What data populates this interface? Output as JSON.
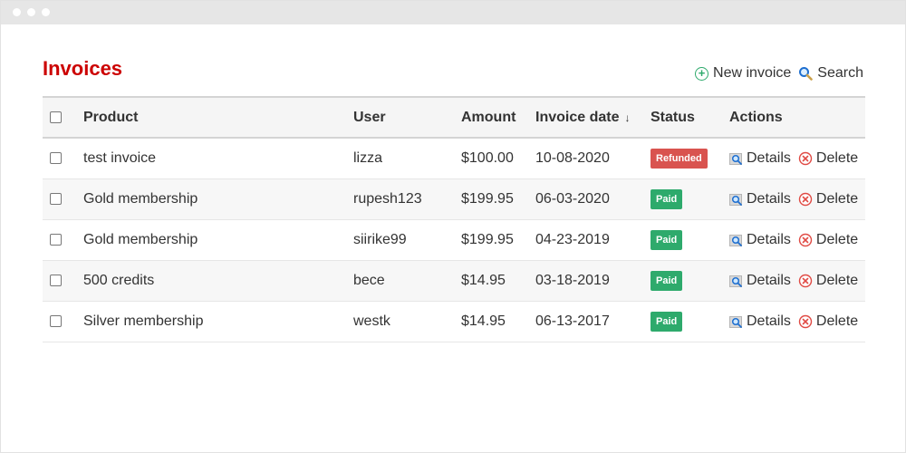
{
  "page": {
    "title": "Invoices"
  },
  "toolbar": {
    "new_label": "New invoice",
    "search_label": "Search"
  },
  "table": {
    "headers": {
      "product": "Product",
      "user": "User",
      "amount": "Amount",
      "date": "Invoice date",
      "status": "Status",
      "actions": "Actions"
    },
    "sort_indicator": "↓",
    "rows": [
      {
        "product": "test invoice",
        "user": "lizza",
        "amount": "$100.00",
        "date": "10-08-2020",
        "status": "Refunded"
      },
      {
        "product": "Gold membership",
        "user": "rupesh123",
        "amount": "$199.95",
        "date": "06-03-2020",
        "status": "Paid"
      },
      {
        "product": "Gold membership",
        "user": "siirike99",
        "amount": "$199.95",
        "date": "04-23-2019",
        "status": "Paid"
      },
      {
        "product": "500 credits",
        "user": "bece",
        "amount": "$14.95",
        "date": "03-18-2019",
        "status": "Paid"
      },
      {
        "product": "Silver membership",
        "user": "westk",
        "amount": "$14.95",
        "date": "06-13-2017",
        "status": "Paid"
      }
    ],
    "actions": {
      "details": "Details",
      "delete": "Delete"
    }
  },
  "icons": {
    "new": "plus-circle-icon",
    "search": "magnifier-icon",
    "details": "magnifier-details-icon",
    "delete": "close-circle-icon"
  },
  "colors": {
    "title": "#cc0000",
    "refunded": "#d9534f",
    "paid": "#2eaa6c"
  }
}
